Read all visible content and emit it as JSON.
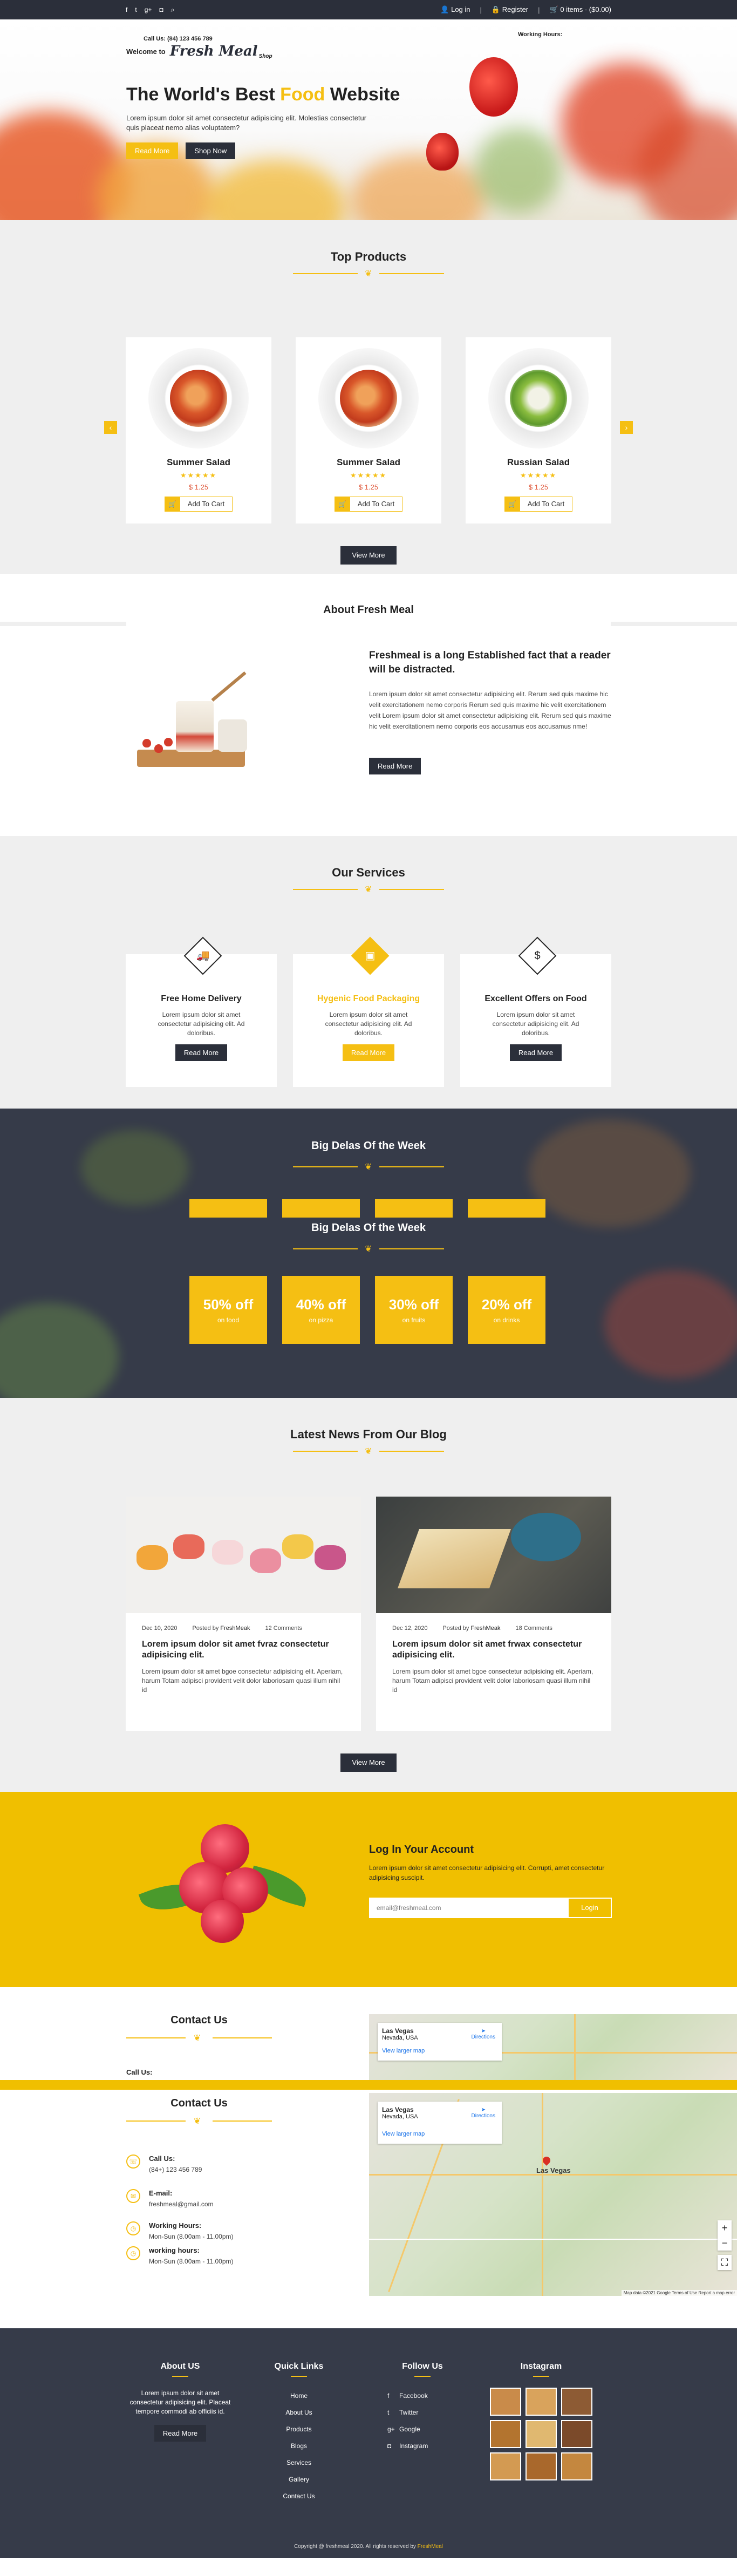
{
  "topbar": {
    "social_icons": [
      "facebook-icon",
      "twitter-icon",
      "google-plus-icon",
      "instagram-icon",
      "search-icon"
    ],
    "login": "Log in",
    "register": "Register",
    "cart": "0 items - ($0.00)"
  },
  "hero": {
    "call": "Call Us: (84) 123 456 789",
    "welcome": "Welcome to",
    "logo": "Fresh Meal",
    "logo_sub": "Shop",
    "working": "Working Hours:",
    "title_a": "The World's Best ",
    "title_accent": "Food",
    "title_b": " Website",
    "lead": "Lorem ipsum dolor sit amet consectetur adipisicing elit. Molestias consectetur quis placeat nemo alias voluptatem?",
    "read_more": "Read More",
    "shop_now": "Shop Now"
  },
  "products": {
    "title": "Top Products",
    "items": [
      {
        "name": "Summer Salad",
        "stars": "★★★★★",
        "price": "$ 1.25",
        "cart": "Add To Cart"
      },
      {
        "name": "Summer Salad",
        "stars": "★★★★★",
        "price": "$ 1.25",
        "cart": "Add To Cart"
      },
      {
        "name": "Russian Salad",
        "stars": "★★★★★",
        "price": "$ 1.25",
        "cart": "Add To Cart"
      }
    ],
    "view_more": "View More"
  },
  "about": {
    "title": "About Fresh Meal",
    "heading": "Freshmeal is a long Established fact that a reader will be distracted.",
    "body": "Lorem ipsum dolor sit amet consectetur adipisicing elit. Rerum sed quis maxime hic velit exercitationem nemo corporis Rerum sed quis maxime hic velit exercitationem velit Lorem ipsum dolor sit amet consectetur adipisicing elit. Rerum sed quis maxime hic velit exercitationem nemo corporis eos accusamus eos accusamus nme!",
    "button": "Read More"
  },
  "services": {
    "title": "Our Services",
    "items": [
      {
        "title": "Free Home Delivery",
        "text": "Lorem ipsum dolor sit amet consectetur adipisicing elit. Ad doloribus.",
        "button": "Read More"
      },
      {
        "title": "Hygenic Food Packaging",
        "text": "Lorem ipsum dolor sit amet consectetur adipisicing elit. Ad doloribus.",
        "button": "Read More"
      },
      {
        "title": "Excellent Offers on Food",
        "text": "Lorem ipsum dolor sit amet consectetur adipisicing elit. Ad doloribus.",
        "button": "Read More"
      }
    ]
  },
  "deals": {
    "title": "Big Delas Of the Week",
    "items": [
      {
        "value": "50% off",
        "sub": "on food"
      },
      {
        "value": "40% off",
        "sub": "on pizza"
      },
      {
        "value": "30% off",
        "sub": "on fruits"
      },
      {
        "value": "20% off",
        "sub": "on drinks"
      }
    ]
  },
  "blog": {
    "title": "Latest News From Our Blog",
    "posts": [
      {
        "date": "Dec 10, 2020",
        "by": "Posted by",
        "author": "FreshMeak",
        "comments": "12 Comments",
        "title": "Lorem ipsum dolor sit amet fvraz consectetur adipisicing elit.",
        "text": "Lorem ipsum dolor sit amet bgoe consectetur adipisicing elit. Aperiam, harum Totam adipisci provident velit dolor laboriosam quasi illum nihil id"
      },
      {
        "date": "Dec 12, 2020",
        "by": "Posted by",
        "author": "FreshMeak",
        "comments": "18 Comments",
        "title": "Lorem ipsum dolor sit amet frwax consectetur adipisicing elit.",
        "text": "Lorem ipsum dolor sit amet bgoe consectetur adipisicing elit. Aperiam, harum Totam adipisci provident velit dolor laboriosam quasi illum nihil id"
      }
    ],
    "view_more": "View More"
  },
  "login": {
    "title": "Log In Your Account",
    "text": "Lorem ipsum dolor sit amet consectetur adipisicing elit. Corrupti, amet consectetur adipisicing suscipit.",
    "placeholder": "email@freshmeal.com",
    "button": "Login"
  },
  "contact": {
    "title": "Contact Us",
    "call_label": "Call Us:",
    "call_value": "(84+) 123 456 789",
    "email_label": "E-mail:",
    "email_value": "freshmeal@gmail.com",
    "hours_label": "Working Hours:",
    "hours_value": "Mon-Sun (8.00am - 11.00pm)",
    "hours2_label": "working hours:",
    "hours2_value": "Mon-Sun (8.00am - 11.00pm)",
    "map": {
      "place": "Las Vegas",
      "region": "Nevada, USA",
      "directions": "Directions",
      "larger": "View larger map",
      "city": "Las Vegas",
      "attribution": "Map data ©2021 Google  Terms of Use  Report a map error"
    }
  },
  "footer": {
    "about_title": "About US",
    "about_text": "Lorem ipsum dolor sit amet consectetur adipisicing elit. Placeat tempore commodi ab officiis id.",
    "about_button": "Read More",
    "links_title": "Quick Links",
    "links": [
      "Home",
      "About Us",
      "Products",
      "Blogs",
      "Services",
      "Gallery",
      "Contact Us"
    ],
    "follow_title": "Follow Us",
    "follow": [
      {
        "icon": "facebook-icon",
        "label": "Facebook"
      },
      {
        "icon": "twitter-icon",
        "label": "Twitter"
      },
      {
        "icon": "google-plus-icon",
        "label": "Google"
      },
      {
        "icon": "instagram-icon",
        "label": "Instagram"
      }
    ],
    "insta_title": "Instagram",
    "copyright": "Copyright @ freshmeal 2020. All rights reserved by ",
    "copyright_brand": "FreshMeal"
  },
  "colors": {
    "accent": "#f5bf13",
    "dark": "#2b2f3a",
    "login_bg": "#f0bf00"
  }
}
